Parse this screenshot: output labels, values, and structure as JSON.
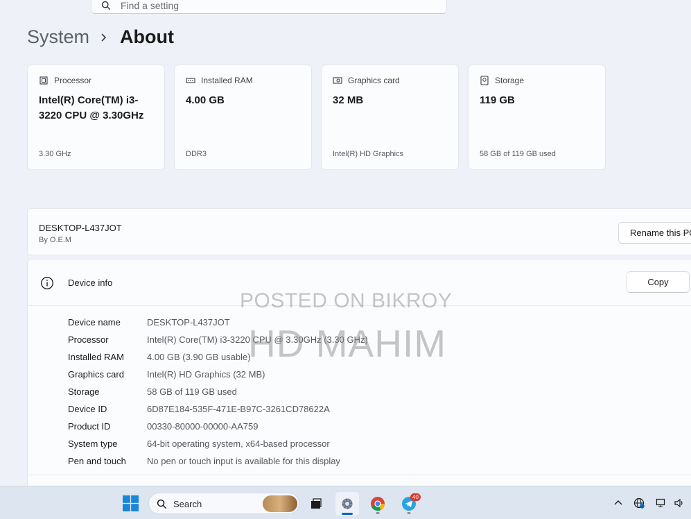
{
  "search": {
    "placeholder": "Find a setting"
  },
  "breadcrumb": {
    "parent": "System",
    "current": "About"
  },
  "spec_cards": [
    {
      "label": "Processor",
      "value": "Intel(R) Core(TM) i3-3220 CPU @ 3.30GHz",
      "sub": "3.30 GHz",
      "icon": "processor-icon"
    },
    {
      "label": "Installed RAM",
      "value": "4.00 GB",
      "sub": "DDR3",
      "icon": "ram-icon"
    },
    {
      "label": "Graphics card",
      "value": "32 MB",
      "sub": "Intel(R) HD Graphics",
      "icon": "graphics-card-icon"
    },
    {
      "label": "Storage",
      "value": "119 GB",
      "sub": "58 GB of 119 GB used",
      "icon": "storage-icon"
    }
  ],
  "pc": {
    "name": "DESKTOP-L437JOT",
    "by": "By O.E.M",
    "rename_label": "Rename this PC"
  },
  "device_info": {
    "title": "Device info",
    "copy_label": "Copy",
    "rows": [
      {
        "key": "Device name",
        "value": "DESKTOP-L437JOT"
      },
      {
        "key": "Processor",
        "value": "Intel(R) Core(TM) i3-3220 CPU @ 3.30GHz (3.30 GHz)"
      },
      {
        "key": "Installed RAM",
        "value": "4.00 GB (3.90 GB usable)"
      },
      {
        "key": "Graphics card",
        "value": "Intel(R) HD Graphics (32 MB)"
      },
      {
        "key": "Storage",
        "value": "58 GB of 119 GB used"
      },
      {
        "key": "Device ID",
        "value": "6D87E184-535F-471E-B97C-3261CD78622A"
      },
      {
        "key": "Product ID",
        "value": "00330-80000-00000-AA759"
      },
      {
        "key": "System type",
        "value": "64-bit operating system, x64-based processor"
      },
      {
        "key": "Pen and touch",
        "value": "No pen or touch input is available for this display"
      }
    ]
  },
  "watermark": {
    "line1": "POSTED ON BIKROY",
    "line2": "HD MAHIM"
  },
  "taskbar": {
    "search_label": "Search",
    "telegram_badge": "40",
    "accent": "#0067c0"
  }
}
